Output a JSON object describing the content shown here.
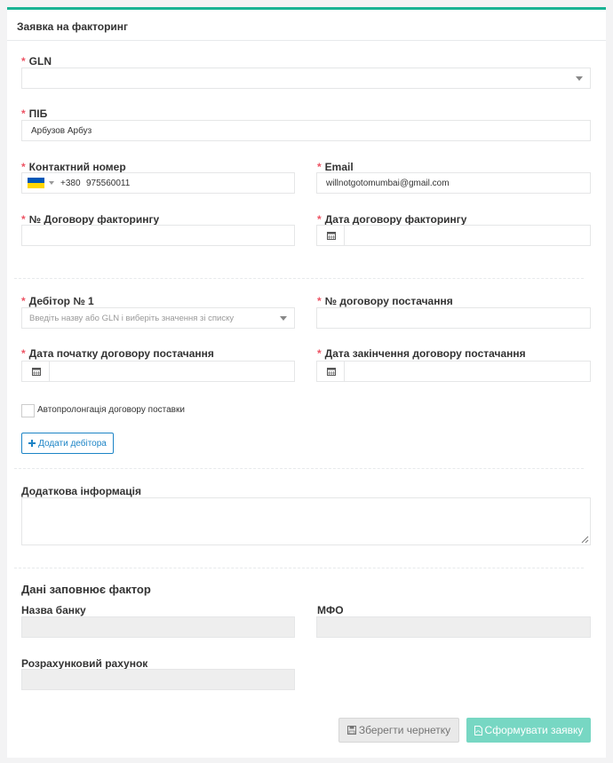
{
  "header": {
    "title": "Заявка на факторинг"
  },
  "fields": {
    "gln": {
      "label": "GLN",
      "value": ""
    },
    "pib": {
      "label": "ПІБ",
      "value": "Арбузов Арбуз"
    },
    "contact_phone": {
      "label": "Контактний номер",
      "country_code": "+380",
      "value": "975560011"
    },
    "email": {
      "label": "Email",
      "value": "willnotgotomumbai@gmail.com"
    },
    "factoring_contract_number": {
      "label": "№ Договору факторингу",
      "value": ""
    },
    "factoring_contract_date": {
      "label": "Дата договору факторингу",
      "value": ""
    },
    "debtor": {
      "label": "Дебітор № 1",
      "placeholder": "Введіть назву або GLN і виберіть значення зі списку"
    },
    "supply_contract_number": {
      "label": "№ договору постачання",
      "value": ""
    },
    "supply_start_date": {
      "label": "Дата початку договору постачання",
      "value": ""
    },
    "supply_end_date": {
      "label": "Дата закінчення договору постачання",
      "value": ""
    },
    "auto_prolongation": {
      "label": "Автопролонгація договору поставки",
      "checked": false
    },
    "additional_info": {
      "label": "Додаткова інформація",
      "value": ""
    }
  },
  "add_debtor_button": {
    "label": "Додати дебітора"
  },
  "factor_section": {
    "title": "Дані заповнює фактор",
    "bank_name": {
      "label": "Назва банку",
      "value": ""
    },
    "mfo": {
      "label": "МФО",
      "value": ""
    },
    "account": {
      "label": "Розрахунковий рахунок",
      "value": ""
    }
  },
  "buttons": {
    "save_draft": "Зберегти чернетку",
    "submit": "Сформувати заявку"
  },
  "required_mark": "*",
  "colors": {
    "accent": "#1ab394",
    "required": "#ed5565",
    "link": "#1c84c6"
  },
  "icons": {
    "flag": "ukraine-flag-icon",
    "calendar": "calendar-icon",
    "plus": "plus-icon",
    "save": "save-icon",
    "pdf": "file-pdf-icon",
    "chevron": "chevron-down-icon"
  }
}
